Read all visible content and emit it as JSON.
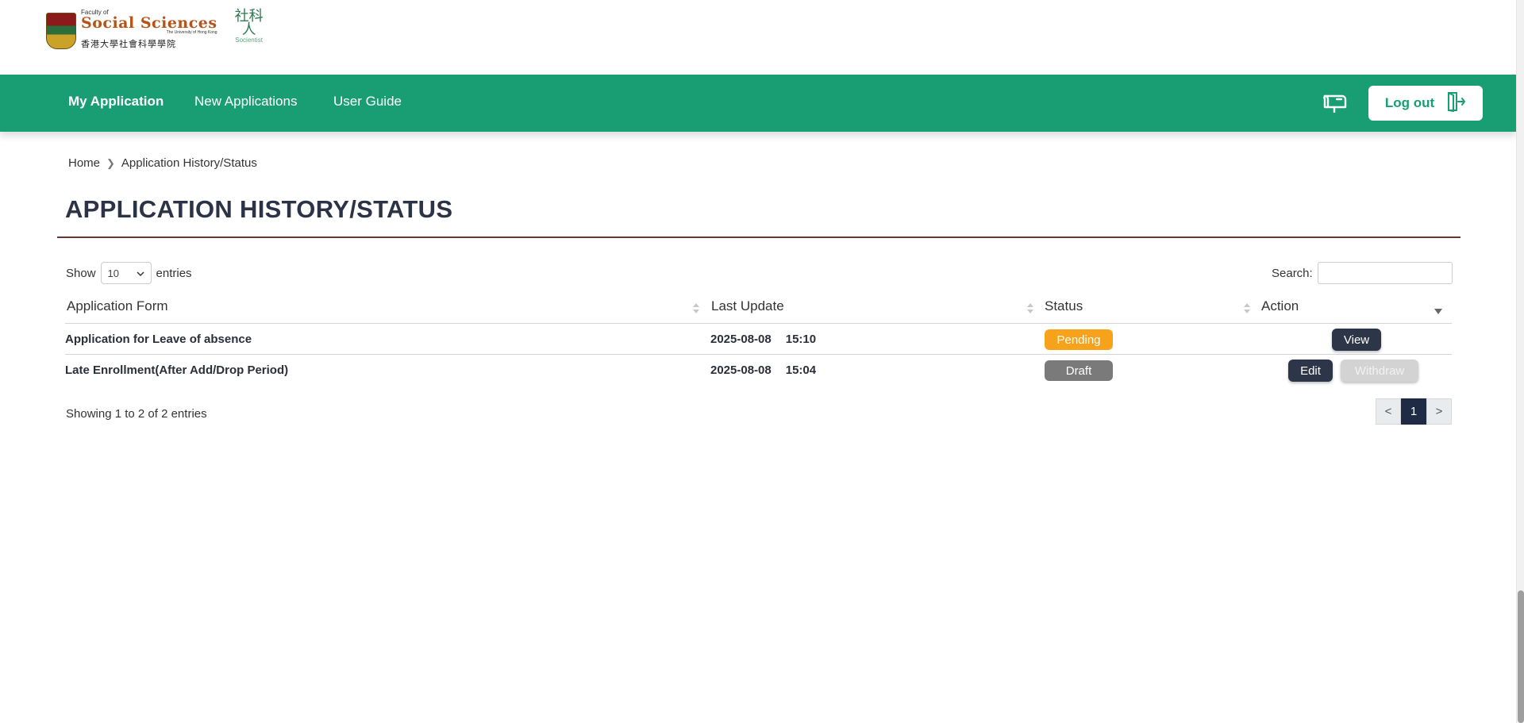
{
  "logo": {
    "faculty_small": "Faculty of",
    "faculty_main": "Social Sciences",
    "university": "The University of Hong Kong",
    "chinese_name": "香港大學社會科學學院",
    "socientist_glyphs": "社科人",
    "socientist_word": "Socientist"
  },
  "nav": {
    "items": [
      {
        "label": "My Application",
        "active": true
      },
      {
        "label": "New Applications",
        "active": false
      },
      {
        "label": "User Guide",
        "active": false
      }
    ],
    "logout_label": "Log out",
    "mail_icon": "mailbox-icon",
    "logout_icon": "logout-door-icon"
  },
  "breadcrumb": {
    "home": "Home",
    "current": "Application History/Status"
  },
  "page_title": "APPLICATION HISTORY/STATUS",
  "table_controls": {
    "show_label": "Show",
    "entries_value": "10",
    "entries_label": "entries",
    "search_label": "Search:",
    "search_value": ""
  },
  "table": {
    "columns": [
      "Application Form",
      "Last Update",
      "Status",
      "Action"
    ],
    "rows": [
      {
        "form": "Application for Leave of absence",
        "date": "2025-08-08",
        "time": "15:10",
        "status": "Pending",
        "actions": [
          "View"
        ]
      },
      {
        "form": "Late Enrollment(After Add/Drop Period)",
        "date": "2025-08-08",
        "time": "15:04",
        "status": "Draft",
        "actions": [
          "Edit",
          "Withdraw"
        ]
      }
    ]
  },
  "info_text": "Showing 1 to 2 of 2 entries",
  "pagination": {
    "prev": "<",
    "current": "1",
    "next": ">"
  },
  "colors": {
    "nav_green": "#189e72",
    "pending": "#f7a21b",
    "draft": "#7a7a7a",
    "dark_button": "#2d3548",
    "title": "#2c3347"
  }
}
